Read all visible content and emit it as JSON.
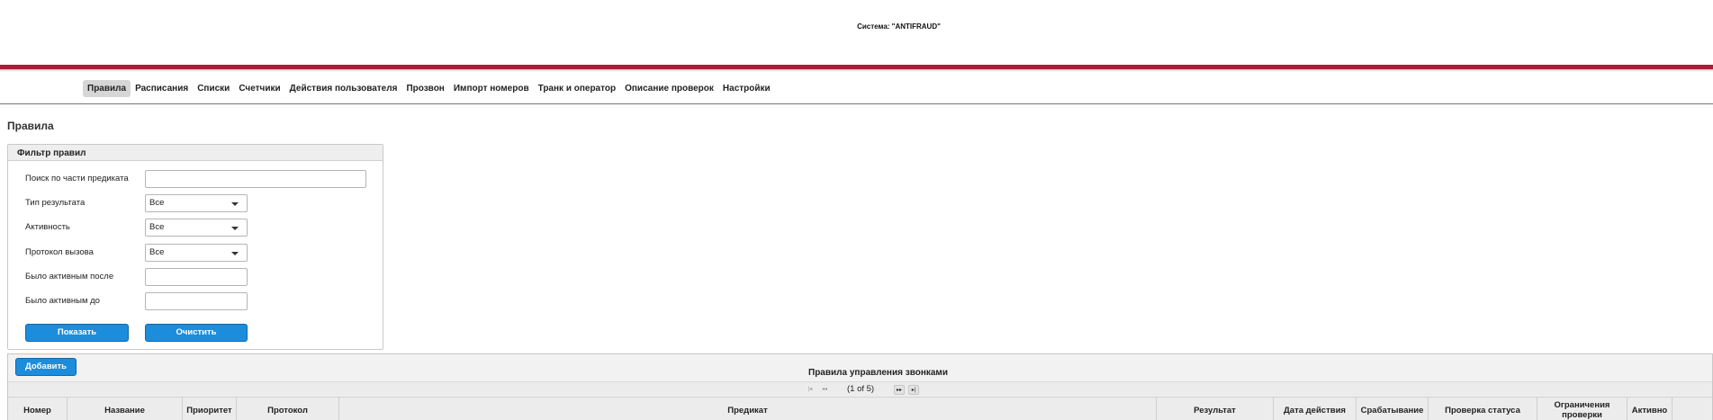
{
  "system_title": "Система: \"ANTIFRAUD\"",
  "nav": {
    "items": [
      {
        "label": "Правила",
        "active": true
      },
      {
        "label": "Расписания",
        "active": false
      },
      {
        "label": "Списки",
        "active": false
      },
      {
        "label": "Счетчики",
        "active": false
      },
      {
        "label": "Действия пользователя",
        "active": false
      },
      {
        "label": "Прозвон",
        "active": false
      },
      {
        "label": "Импорт номеров",
        "active": false
      },
      {
        "label": "Транк и оператор",
        "active": false
      },
      {
        "label": "Описание проверок",
        "active": false
      },
      {
        "label": "Настройки",
        "active": false
      }
    ]
  },
  "page_title": "Правила",
  "filter": {
    "header": "Фильтр правил",
    "predicate_search": {
      "label": "Поиск по части предиката",
      "value": ""
    },
    "result_type": {
      "label": "Тип результата",
      "value": "Все"
    },
    "activity": {
      "label": "Активность",
      "value": "Все"
    },
    "call_protocol": {
      "label": "Протокол вызова",
      "value": "Все"
    },
    "active_after": {
      "label": "Было активным после",
      "value": ""
    },
    "active_before": {
      "label": "Было активным до",
      "value": ""
    },
    "show_button": "Показать",
    "clear_button": "Очистить"
  },
  "table": {
    "add_button": "Добавить",
    "caption": "Правила управления звонками",
    "pager": {
      "first": "|◂",
      "prev": "◂◂",
      "page_text": "(1 of 5)",
      "next": "▸▸",
      "last": "▸|"
    },
    "columns": [
      "Номер",
      "Название",
      "Приоритет",
      "Протокол",
      "Предикат",
      "Результат",
      "Дата действия",
      "Срабатывание",
      "Проверка статуса",
      "Ограничения проверки",
      "Активно"
    ]
  },
  "colors": {
    "accent_bar": "#b01a3a",
    "button": "#1c8ddd"
  }
}
